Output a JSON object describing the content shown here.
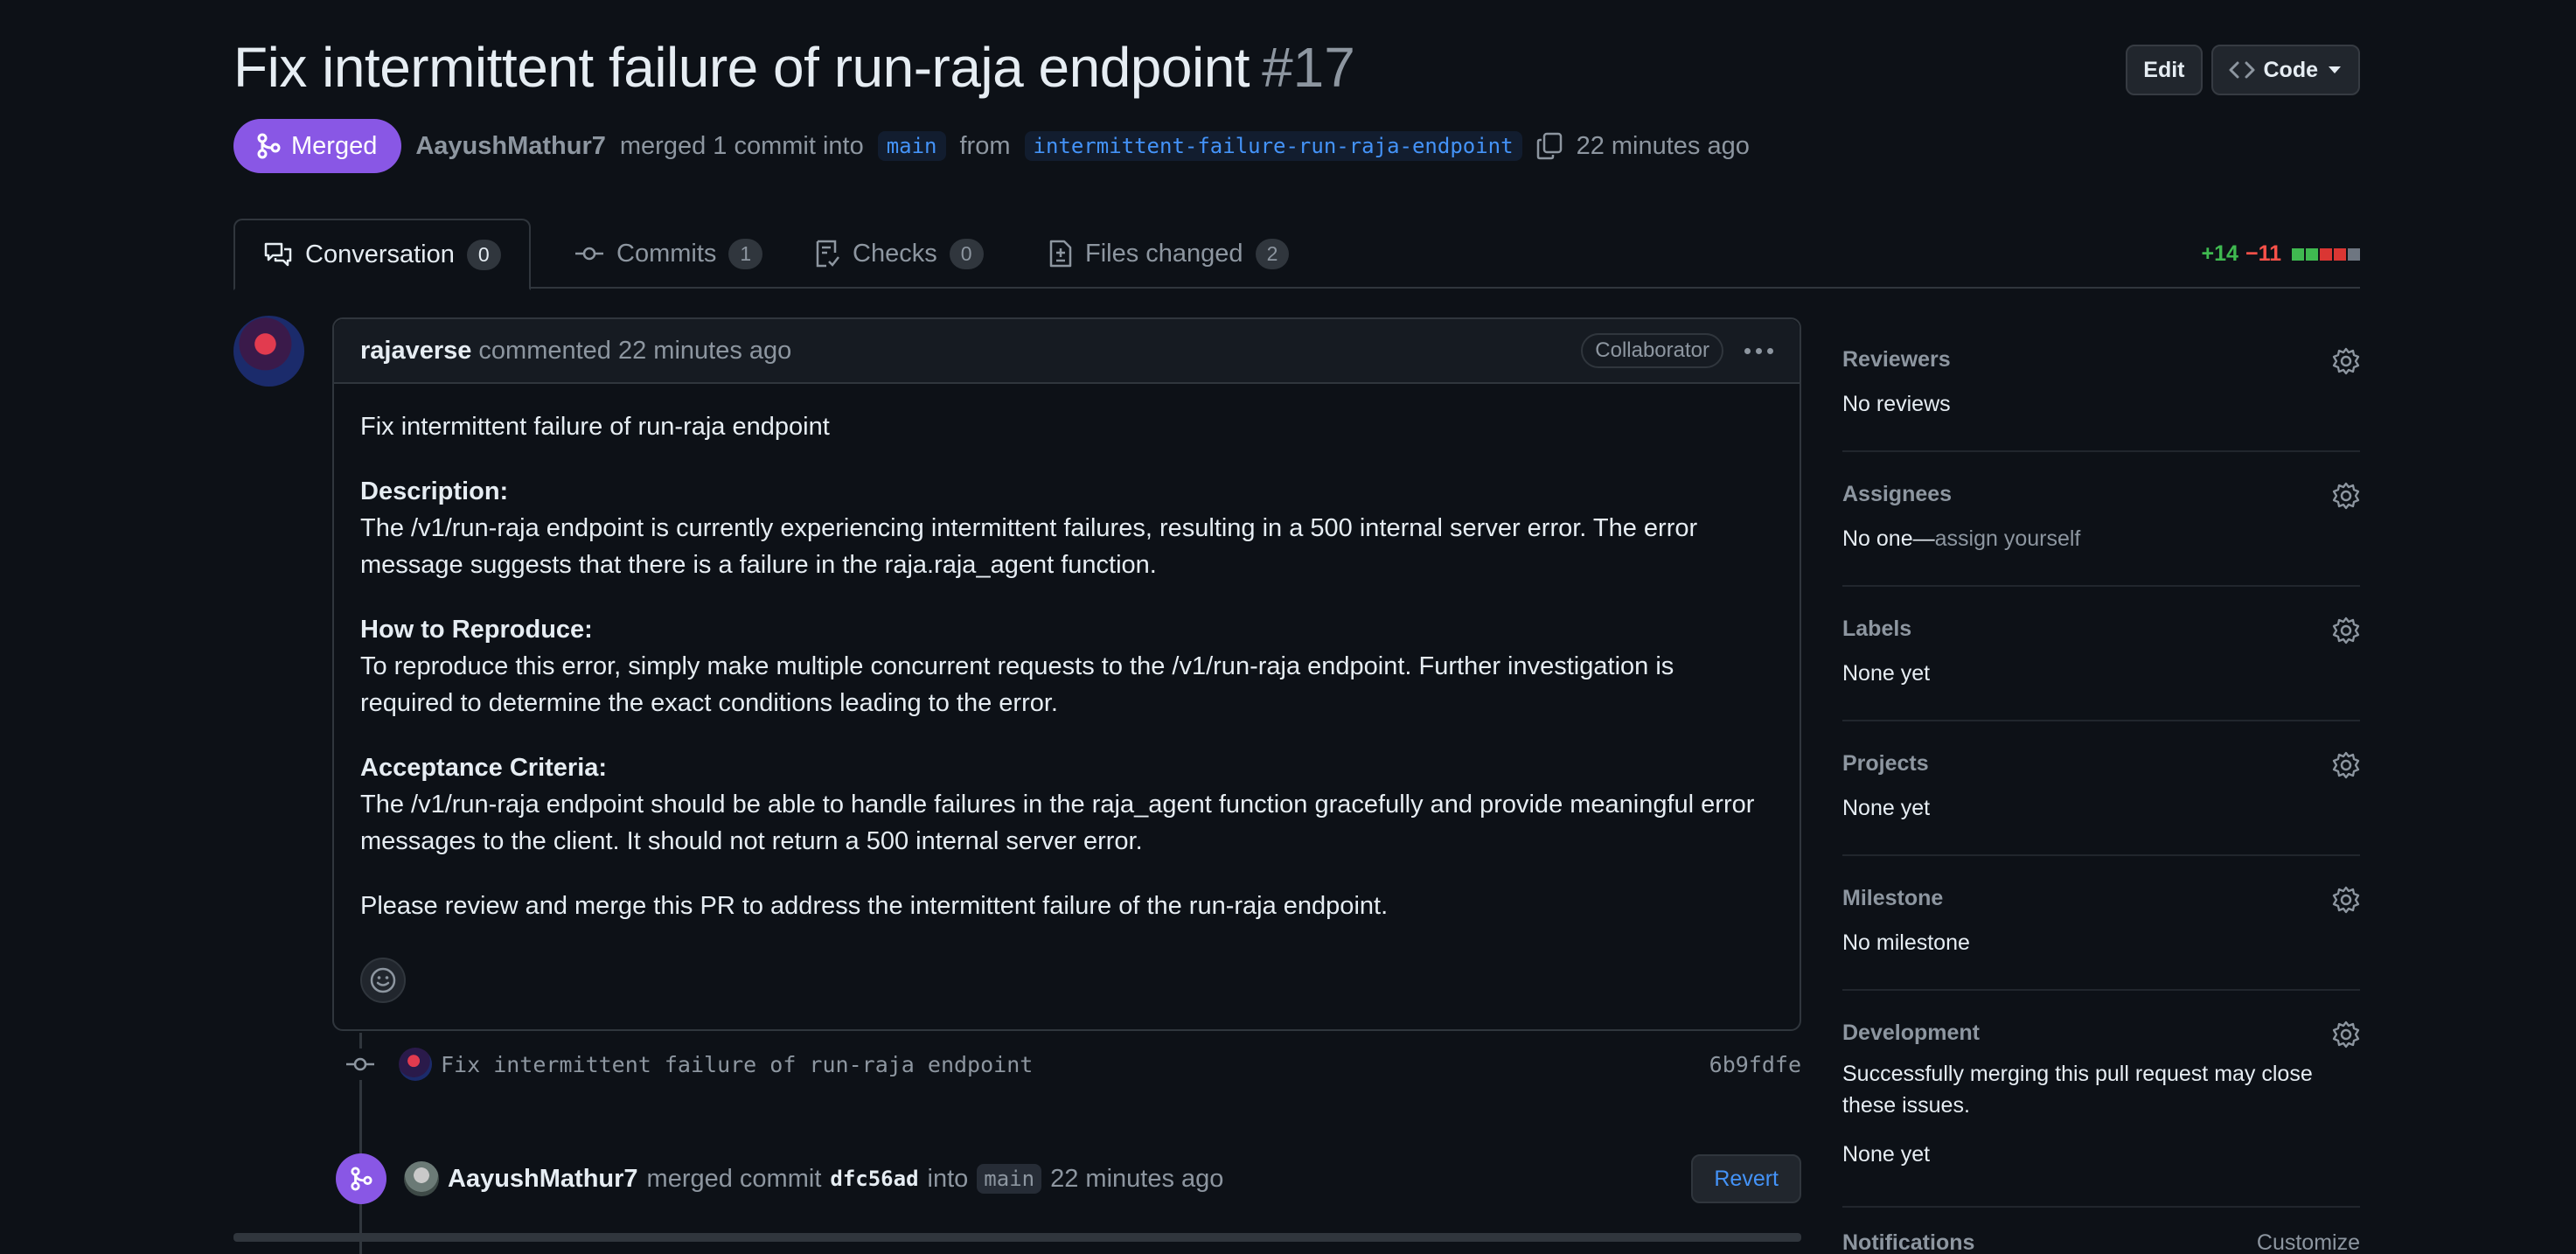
{
  "pr": {
    "title": "Fix intermittent failure of run-raja endpoint",
    "number": "#17",
    "state": "Merged",
    "author": "AayushMathur7",
    "merged_text": "merged 1 commit into",
    "base_branch": "main",
    "from_text": "from",
    "head_branch": "intermittent-failure-run-raja-endpoint",
    "time": "22 minutes ago"
  },
  "header_actions": {
    "edit": "Edit",
    "code": "Code"
  },
  "tabs": [
    {
      "label": "Conversation",
      "count": "0"
    },
    {
      "label": "Commits",
      "count": "1"
    },
    {
      "label": "Checks",
      "count": "0"
    },
    {
      "label": "Files changed",
      "count": "2"
    }
  ],
  "diffstat": {
    "additions": "+14",
    "deletions": "−11",
    "colors": [
      "#3fb950",
      "#3fb950",
      "#da3633",
      "#da3633",
      "#6e7681"
    ]
  },
  "comment": {
    "author": "rajaverse",
    "action": "commented 22 minutes ago",
    "role": "Collaborator",
    "intro": "Fix intermittent failure of run-raja endpoint",
    "description_heading": "Description:",
    "description": "The /v1/run-raja endpoint is currently experiencing intermittent failures, resulting in a 500 internal server error. The error message suggests that there is a failure in the raja.raja_agent function.",
    "reproduce_heading": "How to Reproduce:",
    "reproduce": "To reproduce this error, simply make multiple concurrent requests to the /v1/run-raja endpoint. Further investigation is required to determine the exact conditions leading to the error.",
    "criteria_heading": "Acceptance Criteria:",
    "criteria": "The /v1/run-raja endpoint should be able to handle failures in the raja_agent function gracefully and provide meaningful error messages to the client. It should not return a 500 internal server error.",
    "closing": "Please review and merge this PR to address the intermittent failure of the run-raja endpoint."
  },
  "commit": {
    "message": "Fix intermittent failure of run-raja endpoint",
    "sha": "6b9fdfe"
  },
  "merge_event": {
    "author": "AayushMathur7",
    "text": "merged commit",
    "sha": "dfc56ad",
    "into": "into",
    "branch": "main",
    "time": "22 minutes ago",
    "revert": "Revert"
  },
  "sidebar": {
    "reviewers": {
      "title": "Reviewers",
      "value": "No reviews"
    },
    "assignees": {
      "title": "Assignees",
      "value": "No one—",
      "link": "assign yourself"
    },
    "labels": {
      "title": "Labels",
      "value": "None yet"
    },
    "projects": {
      "title": "Projects",
      "value": "None yet"
    },
    "milestone": {
      "title": "Milestone",
      "value": "No milestone"
    },
    "development": {
      "title": "Development",
      "text": "Successfully merging this pull request may close these issues.",
      "value": "None yet"
    },
    "notifications": {
      "title": "Notifications",
      "action": "Customize"
    }
  }
}
